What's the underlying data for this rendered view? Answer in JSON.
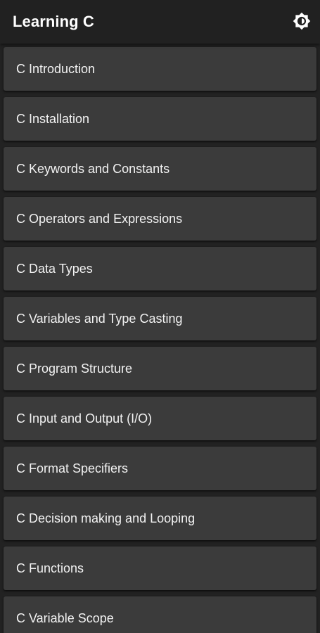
{
  "app_bar": {
    "title": "Learning C",
    "action_icon": "brightness-icon"
  },
  "topics": [
    {
      "label": "C Introduction"
    },
    {
      "label": "C Installation"
    },
    {
      "label": "C Keywords and Constants"
    },
    {
      "label": "C Operators and Expressions"
    },
    {
      "label": "C Data Types"
    },
    {
      "label": "C Variables and Type Casting"
    },
    {
      "label": "C Program Structure"
    },
    {
      "label": "C Input and Output (I/O)"
    },
    {
      "label": "C Format Specifiers"
    },
    {
      "label": "C Decision making and Looping"
    },
    {
      "label": "C Functions"
    },
    {
      "label": "C Variable Scope"
    }
  ]
}
